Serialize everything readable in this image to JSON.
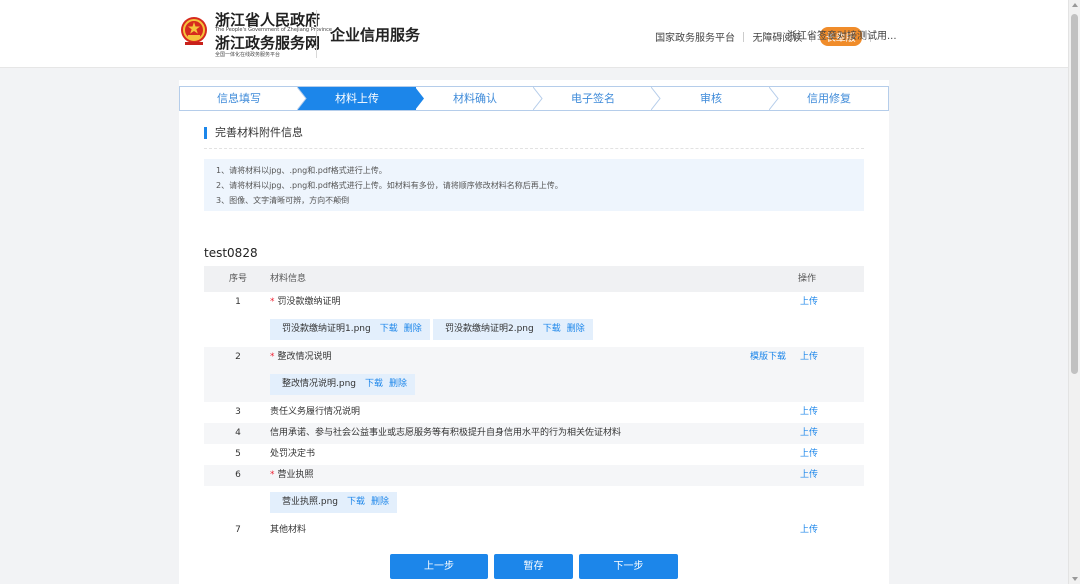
{
  "header": {
    "gov_name": "浙江省人民政府",
    "gov_name_en": "The People's Government of Zhejiang Province",
    "portal_name": "浙江政务服务网",
    "portal_slogan": "全国一体化在线政务服务平台",
    "app_title": "企业信用服务",
    "links": [
      "国家政务服务平台",
      "无障碍阅读"
    ],
    "elder_mode": "长辈版",
    "user": "浙江省签章对接测试用..."
  },
  "steps": [
    {
      "label": "信息填写",
      "active": false
    },
    {
      "label": "材料上传",
      "active": true
    },
    {
      "label": "材料确认",
      "active": false
    },
    {
      "label": "电子签名",
      "active": false
    },
    {
      "label": "审核",
      "active": false
    },
    {
      "label": "信用修复",
      "active": false
    }
  ],
  "section_title": "完善材料附件信息",
  "notes": [
    "1、请将材料以jpg、.png和.pdf格式进行上传。",
    "2、请将材料以jpg、.png和.pdf格式进行上传。如材料有多份，请将顺序修改材料名称后再上传。",
    "3、图像、文字清晰可辨，方向不颠倒"
  ],
  "company": "test0828",
  "table": {
    "headers": {
      "seq": "序号",
      "info": "材料信息",
      "op": "操作"
    },
    "upload_label": "上传",
    "template_label": "模版下载",
    "download_label": "下载",
    "delete_label": "删除",
    "rows": [
      {
        "seq": "1",
        "name": "罚没款缴纳证明",
        "required": true,
        "files": [
          "罚没款缴纳证明1.png",
          "罚没款缴纳证明2.png"
        ]
      },
      {
        "seq": "2",
        "name": "整改情况说明",
        "required": true,
        "template": true,
        "files": [
          "整改情况说明.png"
        ]
      },
      {
        "seq": "3",
        "name": "责任义务履行情况说明",
        "required": false,
        "files": []
      },
      {
        "seq": "4",
        "name": "信用承诺、参与社会公益事业或志愿服务等有积极提升自身信用水平的行为相关佐证材料",
        "required": false,
        "files": []
      },
      {
        "seq": "5",
        "name": "处罚决定书",
        "required": false,
        "files": []
      },
      {
        "seq": "6",
        "name": "营业执照",
        "required": true,
        "files": [
          "营业执照.png"
        ]
      },
      {
        "seq": "7",
        "name": "其他材料",
        "required": false,
        "files": []
      }
    ]
  },
  "buttons": {
    "prev": "上一步",
    "save": "暂存",
    "next": "下一步"
  }
}
